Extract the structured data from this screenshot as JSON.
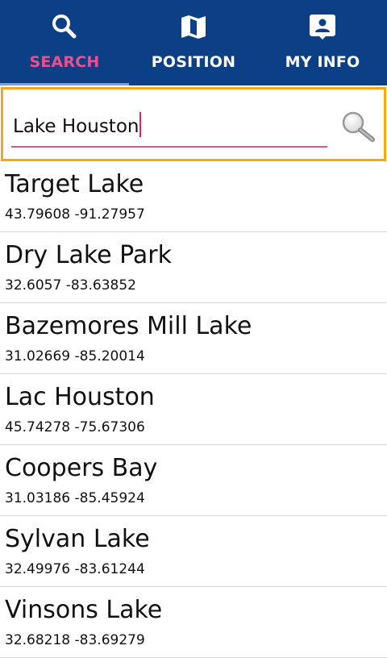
{
  "tabs": [
    {
      "label": "SEARCH",
      "icon": "search-icon",
      "active": true
    },
    {
      "label": "POSITION",
      "icon": "map-icon",
      "active": false
    },
    {
      "label": "MY INFO",
      "icon": "contact-card-icon",
      "active": false
    }
  ],
  "search": {
    "value": "Lake Houston",
    "button_icon": "magnifier-icon"
  },
  "results": [
    {
      "name": "Target Lake",
      "coords": "43.79608 -91.27957"
    },
    {
      "name": "Dry Lake Park",
      "coords": "32.6057 -83.63852"
    },
    {
      "name": "Bazemores Mill Lake",
      "coords": "31.02669 -85.20014"
    },
    {
      "name": "Lac Houston",
      "coords": "45.74278 -75.67306"
    },
    {
      "name": "Coopers Bay",
      "coords": "31.03186 -85.45924"
    },
    {
      "name": "Sylvan Lake",
      "coords": "32.49976 -83.61244"
    },
    {
      "name": "Vinsons Lake",
      "coords": "32.68218 -83.69279"
    }
  ],
  "colors": {
    "header": "#0b3f86",
    "active_tab": "#ee4f8e",
    "focus_border": "#f5a623",
    "underline": "#e25588"
  }
}
